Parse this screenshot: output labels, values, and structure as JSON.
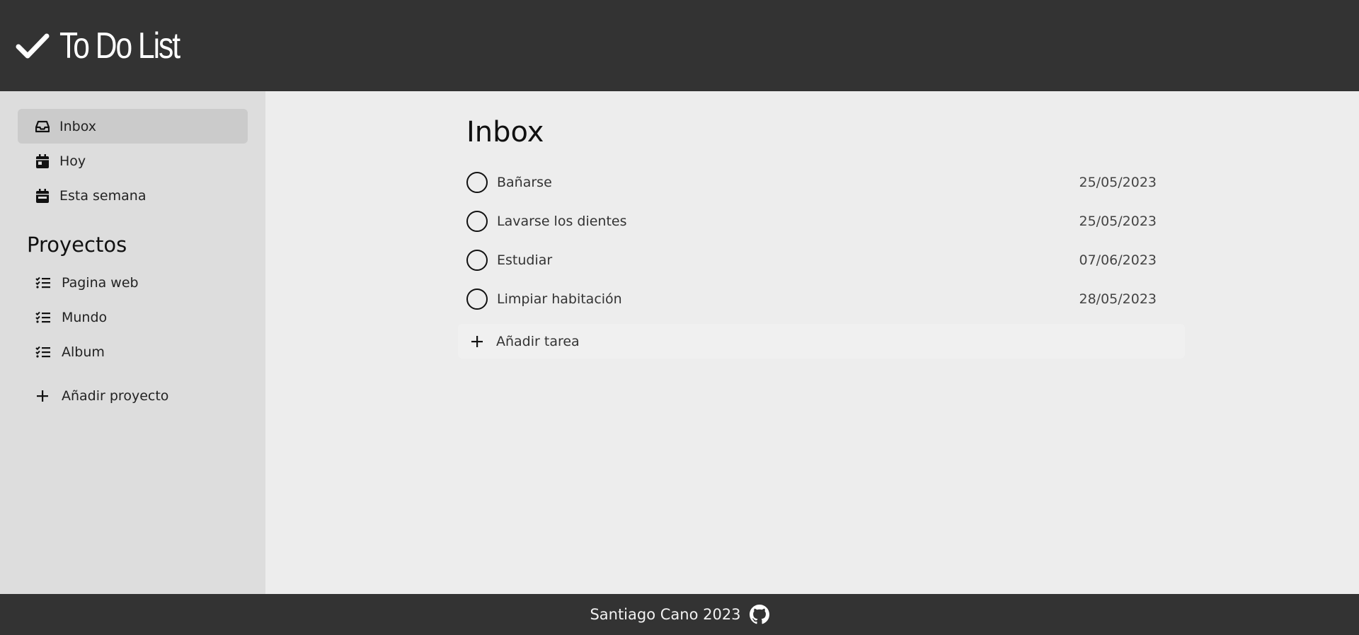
{
  "header": {
    "title": "To Do List",
    "icon": "check-icon"
  },
  "sidebar": {
    "items": [
      {
        "label": "Inbox",
        "icon": "inbox-icon",
        "active": true
      },
      {
        "label": "Hoy",
        "icon": "calendar-day-icon"
      },
      {
        "label": "Esta semana",
        "icon": "calendar-week-icon"
      }
    ],
    "projects_title": "Proyectos",
    "projects": [
      {
        "label": "Pagina web",
        "icon": "list-check-icon"
      },
      {
        "label": "Mundo",
        "icon": "list-check-icon"
      },
      {
        "label": "Album",
        "icon": "list-check-icon"
      }
    ],
    "add_project_label": "Añadir proyecto"
  },
  "main": {
    "title": "Inbox",
    "tasks": [
      {
        "name": "Bañarse",
        "date": "25/05/2023"
      },
      {
        "name": "Lavarse los dientes",
        "date": "25/05/2023"
      },
      {
        "name": "Estudiar",
        "date": "07/06/2023"
      },
      {
        "name": "Limpiar habitación",
        "date": "28/05/2023"
      }
    ],
    "add_task_label": "Añadir tarea"
  },
  "footer": {
    "text": "Santiago Cano 2023",
    "icon": "github-icon"
  },
  "colors": {
    "header_bg": "#333333",
    "sidebar_bg": "#dddddd",
    "active_item_bg": "#cbcbcb",
    "main_bg": "#ededed",
    "footer_bg": "#333333"
  }
}
